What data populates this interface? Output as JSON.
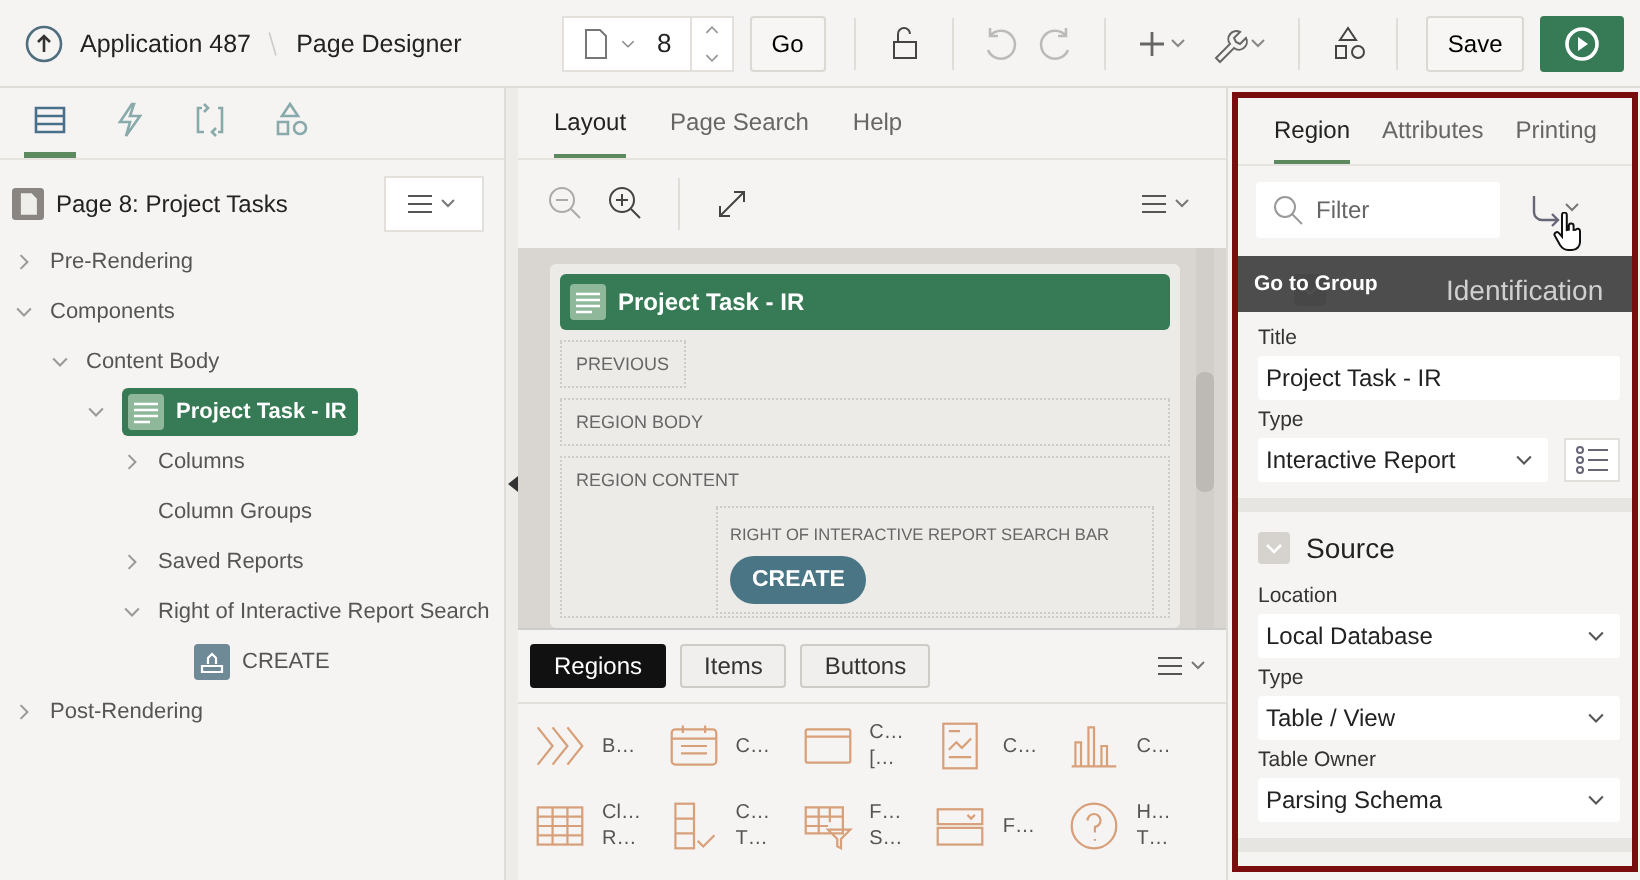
{
  "header": {
    "app": "Application 487",
    "page_title": "Page Designer",
    "page_number": "8",
    "go": "Go",
    "save": "Save"
  },
  "left_tabs": [
    {
      "selected": true
    },
    {
      "selected": false
    },
    {
      "selected": false
    },
    {
      "selected": false
    }
  ],
  "tree": {
    "root": "Page 8: Project Tasks",
    "items": [
      {
        "label": "Pre-Rendering",
        "kind": "folder",
        "expanded": false,
        "selected": false
      },
      {
        "label": "Components",
        "kind": "folder",
        "expanded": true,
        "selected": false,
        "children": [
          {
            "label": "Content Body",
            "kind": "folder",
            "expanded": true,
            "selected": false,
            "children": [
              {
                "label": "Project Task - IR",
                "kind": "region",
                "expanded": true,
                "selected": true,
                "children": [
                  {
                    "label": "Columns",
                    "kind": "folder",
                    "expanded": false,
                    "selected": false
                  },
                  {
                    "label": "Column Groups",
                    "kind": "leaf",
                    "selected": false
                  },
                  {
                    "label": "Saved Reports",
                    "kind": "folder",
                    "expanded": false,
                    "selected": false
                  },
                  {
                    "label": "Right of Interactive Report Search",
                    "kind": "folder",
                    "expanded": true,
                    "selected": false,
                    "children": [
                      {
                        "label": "CREATE",
                        "kind": "button",
                        "selected": false
                      }
                    ]
                  }
                ]
              }
            ]
          }
        ]
      },
      {
        "label": "Post-Rendering",
        "kind": "folder",
        "expanded": false,
        "selected": false
      }
    ]
  },
  "center_tabs": [
    {
      "label": "Layout",
      "selected": true
    },
    {
      "label": "Page Search",
      "selected": false
    },
    {
      "label": "Help",
      "selected": false
    }
  ],
  "layout": {
    "region_title": "Project Task - IR",
    "previous": "PREVIOUS",
    "region_body": "REGION BODY",
    "region_content": "REGION CONTENT",
    "search_bar": "RIGHT OF INTERACTIVE REPORT SEARCH BAR",
    "create": "CREATE"
  },
  "gallery": {
    "tabs": [
      {
        "label": "Regions",
        "selected": true
      },
      {
        "label": "Items",
        "selected": false
      },
      {
        "label": "Buttons",
        "selected": false
      }
    ],
    "items": [
      {
        "lines": [
          "B…"
        ]
      },
      {
        "lines": [
          "C…"
        ]
      },
      {
        "lines": [
          "C…",
          "[…"
        ]
      },
      {
        "lines": [
          "C…"
        ]
      },
      {
        "lines": [
          "C…"
        ]
      },
      {
        "lines": [
          "Cl…",
          "R…"
        ]
      },
      {
        "lines": [
          "C…",
          "T…"
        ]
      },
      {
        "lines": [
          "F…",
          "S…"
        ]
      },
      {
        "lines": [
          "F…"
        ]
      },
      {
        "lines": [
          "H…",
          "T…"
        ]
      }
    ]
  },
  "right_tabs": [
    {
      "label": "Region",
      "selected": true
    },
    {
      "label": "Attributes",
      "selected": false
    },
    {
      "label": "Printing",
      "selected": false
    }
  ],
  "filter": {
    "placeholder": "Filter"
  },
  "tooltip": "Go to Group",
  "sections": [
    {
      "title": "Identification",
      "fields": [
        {
          "label": "Title",
          "value": "Project Task - IR",
          "kind": "text"
        },
        {
          "label": "Type",
          "value": "Interactive Report",
          "kind": "select_list"
        }
      ]
    },
    {
      "title": "Source",
      "fields": [
        {
          "label": "Location",
          "value": "Local Database",
          "kind": "select"
        },
        {
          "label": "Type",
          "value": "Table / View",
          "kind": "select"
        },
        {
          "label": "Table Owner",
          "value": "Parsing Schema",
          "kind": "select"
        }
      ]
    }
  ]
}
